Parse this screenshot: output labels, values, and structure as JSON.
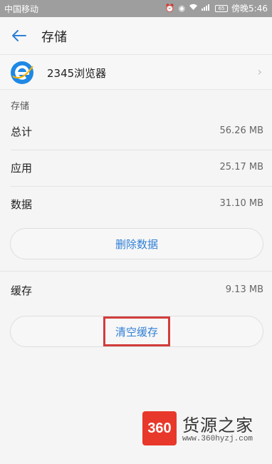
{
  "status_bar": {
    "carrier": "中国移动",
    "signal_text": "4G",
    "battery": "65",
    "time": "傍晚5:46"
  },
  "header": {
    "title": "存储"
  },
  "app": {
    "name": "2345浏览器",
    "icon": "ie-e-icon"
  },
  "section": {
    "label": "存储"
  },
  "stats": [
    {
      "label": "总计",
      "value": "56.26 MB"
    },
    {
      "label": "应用",
      "value": "25.17 MB"
    },
    {
      "label": "数据",
      "value": "31.10 MB"
    }
  ],
  "buttons": {
    "clear_data": "删除数据",
    "clear_cache": "清空缓存"
  },
  "cache": {
    "label": "缓存",
    "value": "9.13 MB"
  },
  "watermark": {
    "logo_text": "360",
    "brand": "货源之家",
    "url": "www.360hyzj.com"
  },
  "colors": {
    "accent": "#2f7fd6",
    "highlight": "#d23c3c",
    "status_bar": "#9e9e9e"
  }
}
